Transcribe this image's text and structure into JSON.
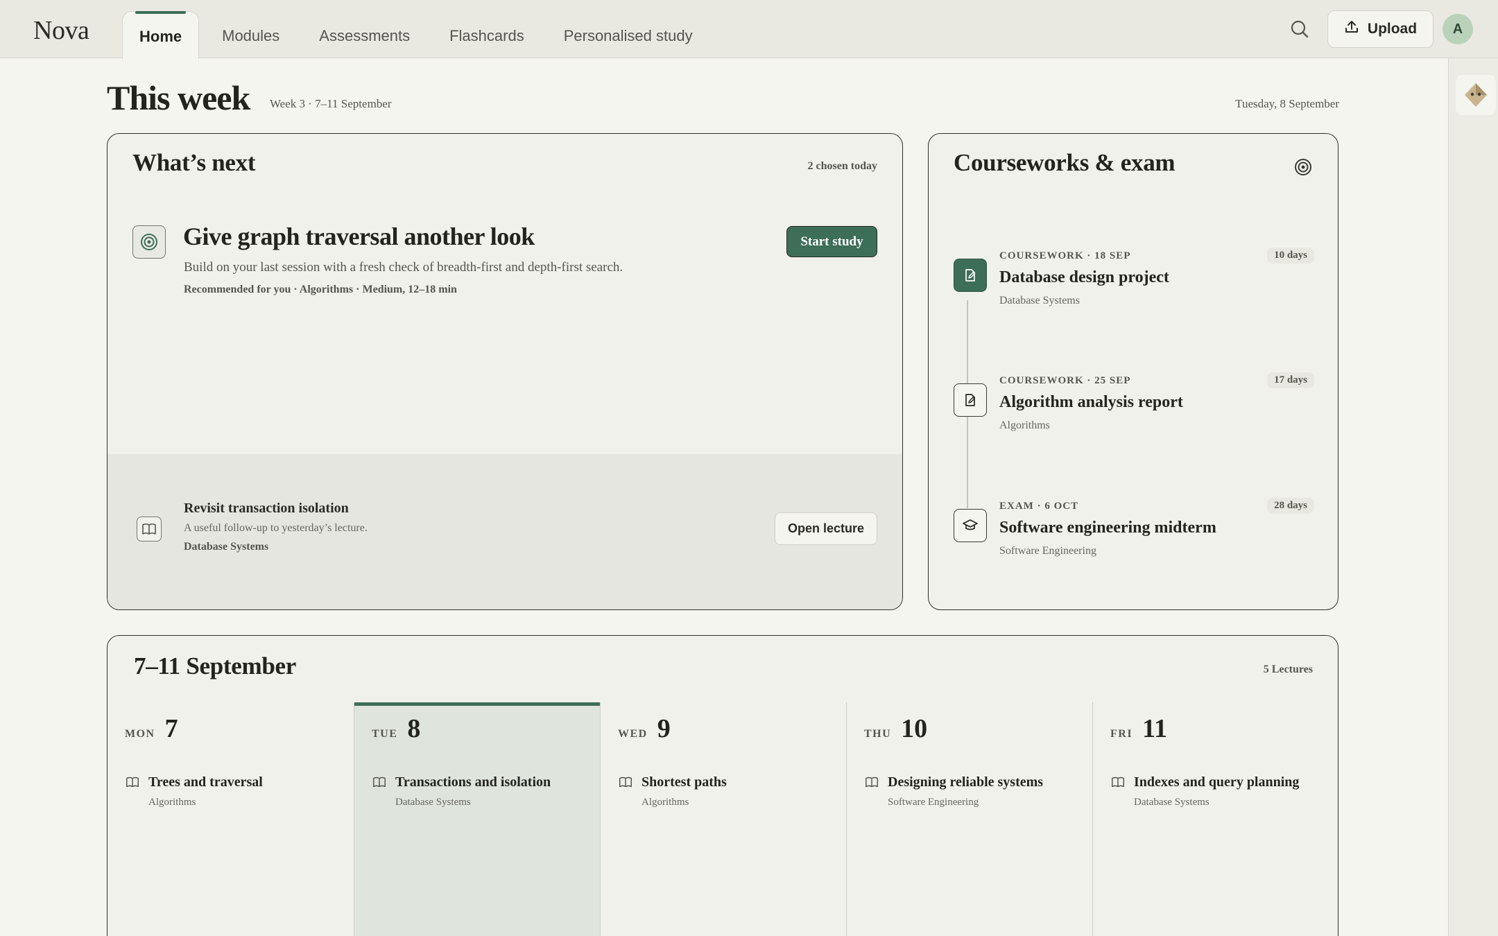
{
  "app": {
    "name": "Nova"
  },
  "nav": {
    "tabs": [
      {
        "label": "Home",
        "active": true
      },
      {
        "label": "Modules"
      },
      {
        "label": "Assessments"
      },
      {
        "label": "Flashcards"
      },
      {
        "label": "Personalised study"
      }
    ],
    "upload_label": "Upload",
    "avatar_initial": "A"
  },
  "header": {
    "title": "This week",
    "week_label": "Week 3 · 7–11 September",
    "date": "Tuesday, 8 September"
  },
  "whats_next": {
    "title": "What’s next",
    "meta": "2 chosen today",
    "recommendation": {
      "title": "Give graph traversal another look",
      "description": "Build on your last session with a fresh check of breadth-first and depth-first search.",
      "meta": "Recommended for you · Algorithms · Medium, 12–18 min",
      "button": "Start study",
      "icon": "target-icon"
    },
    "secondary": {
      "title": "Revisit transaction isolation",
      "description": "A useful follow-up to yesterday’s lecture.",
      "module": "Database Systems",
      "button": "Open lecture",
      "icon": "book-icon"
    }
  },
  "courseworks": {
    "title": "Courseworks & exam",
    "items": [
      {
        "kind": "COURSEWORK · 18 SEP",
        "name": "Database design project",
        "module": "Database Systems",
        "days": "10 days",
        "icon": "edit-document-icon",
        "highlighted": true
      },
      {
        "kind": "COURSEWORK · 25 SEP",
        "name": "Algorithm analysis report",
        "module": "Algorithms",
        "days": "17 days",
        "icon": "edit-document-icon"
      },
      {
        "kind": "EXAM · 6 OCT",
        "name": "Software engineering midterm",
        "module": "Software Engineering",
        "days": "28 days",
        "icon": "graduation-cap-icon"
      }
    ]
  },
  "week": {
    "title": "7–11 September",
    "meta": "5 Lectures",
    "days": [
      {
        "abbr": "MON",
        "num": "7",
        "lecture": "Trees and traversal",
        "module": "Algorithms"
      },
      {
        "abbr": "TUE",
        "num": "8",
        "lecture": "Transactions and isolation",
        "module": "Database Systems",
        "today": true
      },
      {
        "abbr": "WED",
        "num": "9",
        "lecture": "Shortest paths",
        "module": "Algorithms"
      },
      {
        "abbr": "THU",
        "num": "10",
        "lecture": "Designing reliable systems",
        "module": "Software Engineering"
      },
      {
        "abbr": "FRI",
        "num": "11",
        "lecture": "Indexes and query planning",
        "module": "Database Systems"
      }
    ]
  },
  "colors": {
    "accent": "#3d6e57",
    "background": "#f5f5ef"
  }
}
